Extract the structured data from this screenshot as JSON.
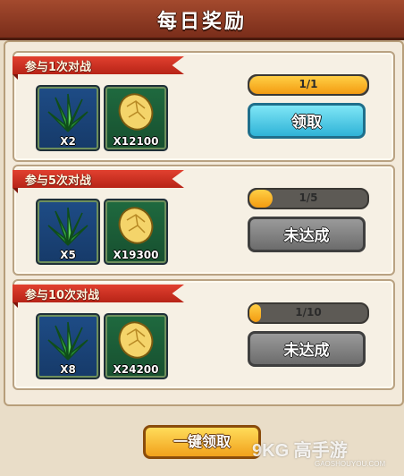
{
  "header": {
    "title": "每日奖励"
  },
  "cards": [
    {
      "title": "参与1次对战",
      "progress_text": "1/1",
      "progress": 1.0,
      "button_label": "领取",
      "button_state": "active",
      "rewards": [
        {
          "icon": "herb-icon",
          "quantity": "X2"
        },
        {
          "icon": "gold-nugget-icon",
          "quantity": "X12100"
        }
      ]
    },
    {
      "title": "参与5次对战",
      "progress_text": "1/5",
      "progress": 0.2,
      "button_label": "未达成",
      "button_state": "disabled",
      "rewards": [
        {
          "icon": "herb-icon",
          "quantity": "X5"
        },
        {
          "icon": "gold-nugget-icon",
          "quantity": "X19300"
        }
      ]
    },
    {
      "title": "参与10次对战",
      "progress_text": "1/10",
      "progress": 0.1,
      "button_label": "未达成",
      "button_state": "disabled",
      "rewards": [
        {
          "icon": "herb-icon",
          "quantity": "X8"
        },
        {
          "icon": "gold-nugget-icon",
          "quantity": "X24200"
        }
      ]
    }
  ],
  "footer": {
    "claim_all_label": "一键领取"
  },
  "watermark": {
    "text": "9KG 高手游",
    "url": "GAOSHOUYOU.COM"
  },
  "colors": {
    "header": "#8a3620",
    "ribbon": "#d0321f",
    "progress_fill": "#f7b22a",
    "button_active": "#3fbfe0",
    "button_disabled": "#7d7d7d",
    "footer_button": "#f4b024"
  }
}
